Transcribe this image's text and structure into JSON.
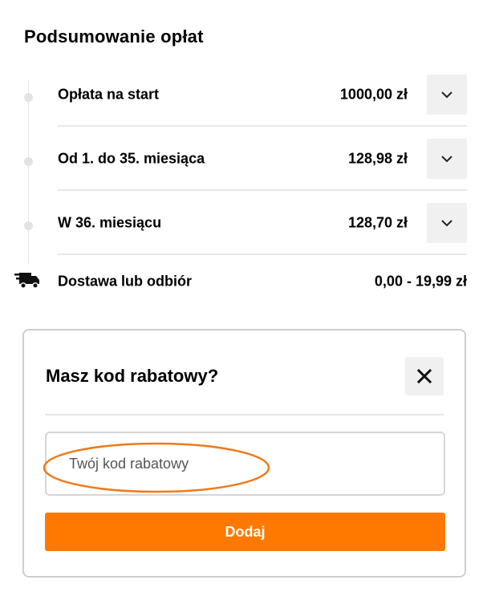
{
  "summary": {
    "title": "Podsumowanie opłat",
    "rows": [
      {
        "label": "Opłata na start",
        "amount": "1000,00 zł",
        "toggle_icon": "chevron-down-icon"
      },
      {
        "label": "Od 1. do 35. miesiąca",
        "amount": "128,98 zł",
        "toggle_icon": "chevron-down-icon"
      },
      {
        "label": "W 36. miesiącu",
        "amount": "128,70 zł",
        "toggle_icon": "chevron-down-icon"
      }
    ],
    "delivery": {
      "icon": "truck-icon",
      "label": "Dostawa lub odbiór",
      "amount": "0,00 - 19,99 zł"
    }
  },
  "promo": {
    "title": "Masz kod rabatowy?",
    "close_icon": "close-icon",
    "input_value": "",
    "input_placeholder": "Twój kod rabatowy",
    "highlight_color": "#f07a1a",
    "add_label": "Dodaj"
  },
  "colors": {
    "accent": "#ff7900",
    "button_text": "#ffffff",
    "toggle_bg": "#f0f0f0",
    "divider": "#e8e8e8"
  }
}
